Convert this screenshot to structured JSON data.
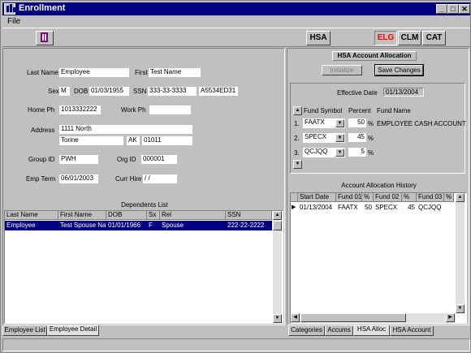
{
  "window": {
    "title": "Enrollment",
    "min": "_",
    "max": "□",
    "close": "✕"
  },
  "menu": {
    "file": "File"
  },
  "toolbar": {
    "hsa": "HSA",
    "elg": "ELG",
    "clm": "CLM",
    "cat": "CAT",
    "colors": {
      "elg": "#ff0000"
    }
  },
  "employee": {
    "last_name_label": "Last Name",
    "last_name": "Employee",
    "first_label": "First",
    "first_name": "Test Name",
    "sex_label": "Sex",
    "sex": "M",
    "dob_label": "DOB",
    "dob": "01/03/1955",
    "ssn_label": "SSN",
    "ssn": "333-33-3333",
    "member_id": "A5534ED31",
    "home_ph_label": "Home Ph",
    "home_ph": "1013332222",
    "work_ph_label": "Work Ph",
    "work_ph": "",
    "address_label": "Address",
    "address1": "1111 North",
    "city": "Torine",
    "state": "AK",
    "zip": "01011",
    "group_id_label": "Group ID",
    "group_id": "PWH",
    "org_id_label": "Org ID",
    "org_id": "000001",
    "emp_term_label": "Emp Term",
    "emp_term": "06/01/2003",
    "curr_hire_label": "Curr Hire",
    "curr_hire": " /  /"
  },
  "dependents": {
    "title": "Dependents List",
    "headers": [
      "Last Name",
      "First Name",
      "DOB",
      "Sx",
      "Rel",
      "SSN"
    ],
    "rows": [
      [
        "Employee",
        "Test Spouse Na",
        "01/01/1966",
        "F",
        "Spouse",
        "222-22-2222"
      ]
    ]
  },
  "left_tabs": [
    "Employee List",
    "Employee Detail"
  ],
  "hsa": {
    "title": "HSA Account Allocation",
    "initialize": "Initialize",
    "save": "Save Changes",
    "effective_label": "Effective Date",
    "effective_date": "01/13/2004",
    "fund_symbol_label": "Fund Symbol",
    "percent_label": "Percent",
    "fund_name_label": "Fund Name",
    "funds": [
      {
        "num": "1.",
        "symbol": "FAATX",
        "percent": "50",
        "pct": "%",
        "name": "EMPLOYEE CASH ACCOUNT"
      },
      {
        "num": "2.",
        "symbol": "SPECX",
        "percent": "45",
        "pct": "%",
        "name": ""
      },
      {
        "num": "3.",
        "symbol": "QCJQQ",
        "percent": "5",
        "pct": "%",
        "name": ""
      }
    ],
    "history_title": "Account Allocation History",
    "history_headers": [
      "Start Date",
      "Fund 01",
      "%",
      "Fund 02",
      "%",
      "Fund 03",
      "%"
    ],
    "history_rows": [
      [
        "01/13/2004",
        "FAATX",
        "50",
        "SPECX",
        "45",
        "QCJQQ"
      ]
    ]
  },
  "right_tabs": [
    "Categories",
    "Accums",
    "HSA Alloc",
    "HSA Account"
  ]
}
